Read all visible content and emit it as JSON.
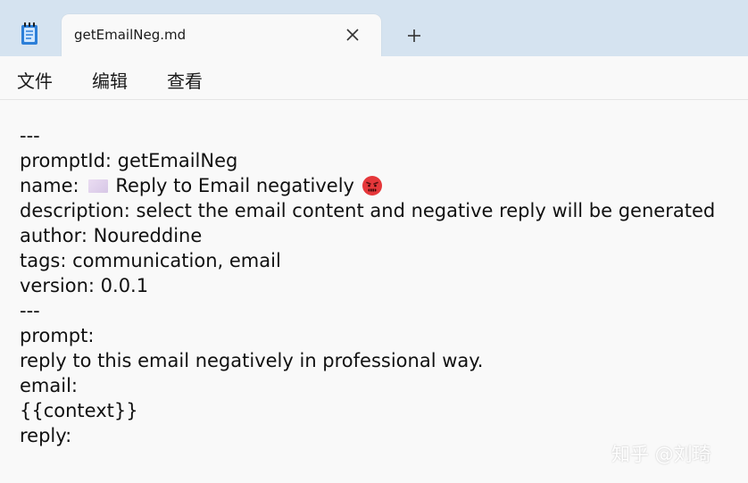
{
  "tab": {
    "title": "getEmailNeg.md"
  },
  "menu": {
    "items": [
      "文件",
      "编辑",
      "查看"
    ]
  },
  "editor": {
    "lines": [
      "---",
      "promptId: getEmailNeg",
      "Reply to Email negatively",
      "description: select the email content and negative reply will be generated",
      "author: Noureddine",
      "tags: communication, email",
      "version: 0.0.1",
      "---",
      "prompt:",
      "reply to this email negatively in professional way.",
      "email:",
      "{{context}}",
      "reply:"
    ],
    "name_key": "name:"
  },
  "watermark": {
    "text": "知乎 @刘琦"
  },
  "icons": {
    "app": "notepad-icon",
    "close": "close-icon",
    "add": "plus-icon",
    "square": "purple-square-emoji",
    "face": "angry-face-emoji"
  },
  "colors": {
    "titlebar": "#d5e3f0",
    "background": "#f9f9f9",
    "text": "#111111"
  }
}
